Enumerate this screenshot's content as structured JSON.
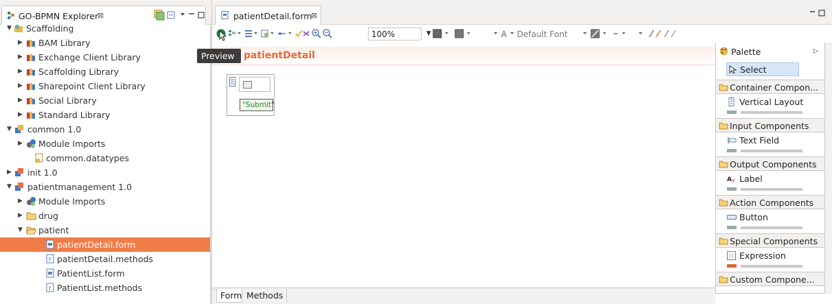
{
  "explorer": {
    "title": "GO-BPMN Explorer",
    "close": "⊠",
    "tree": [
      {
        "label": "Scaffolding",
        "expanded": true
      },
      {
        "label": "BAM Library",
        "expanded": false
      },
      {
        "label": "Exchange Client Library",
        "expanded": false
      },
      {
        "label": "Scaffolding Library",
        "expanded": false
      },
      {
        "label": "Sharepoint Client Library",
        "expanded": false
      },
      {
        "label": "Social Library",
        "expanded": false
      },
      {
        "label": "Standard Library",
        "expanded": false
      },
      {
        "label": "common 1.0",
        "expanded": true
      },
      {
        "label": "Module Imports",
        "expanded": false
      },
      {
        "label": "common.datatypes"
      },
      {
        "label": "init 1.0",
        "expanded": false
      },
      {
        "label": "patientmanagement 1.0",
        "expanded": true
      },
      {
        "label": "Module Imports",
        "expanded": false
      },
      {
        "label": "drug",
        "expanded": false
      },
      {
        "label": "patient",
        "expanded": true
      },
      {
        "label": "patientDetail.form",
        "selected": true
      },
      {
        "label": "patientDetail.methods"
      },
      {
        "label": "PatientList.form"
      },
      {
        "label": "PatientList.methods"
      }
    ]
  },
  "editor": {
    "tab_title": "patientDetail.form",
    "close": "⊠",
    "toolbar": {
      "zoom": "100%",
      "font_a": "A",
      "font_name": "Default Font"
    },
    "tooltip": "Preview",
    "form_title": "patientDetail",
    "submit_label": "\"Submit\"",
    "bottom_tabs": {
      "form": "Form",
      "methods": "Methods"
    }
  },
  "palette": {
    "title": "Palette",
    "select": "Select",
    "sections": [
      {
        "label": "Container Compon...",
        "items": [
          "Vertical Layout"
        ]
      },
      {
        "label": "Input Components",
        "items": [
          "Text Field"
        ]
      },
      {
        "label": "Output Components",
        "items": [
          "Label"
        ]
      },
      {
        "label": "Action Components",
        "items": [
          "Button"
        ]
      },
      {
        "label": "Special Components",
        "items": [
          "Expression"
        ]
      },
      {
        "label": "Custom Compone...",
        "items": []
      }
    ]
  },
  "colors": {
    "selection": "#f07c47",
    "form_title": "#e5683a",
    "palette_select": "#d7e6f7"
  }
}
